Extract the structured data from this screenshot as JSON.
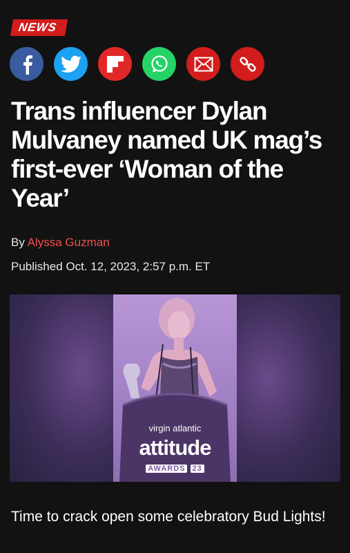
{
  "section_tag": "NEWS",
  "share": [
    {
      "name": "facebook-icon",
      "color": "#3a5ba0"
    },
    {
      "name": "twitter-icon",
      "color": "#1da1f2"
    },
    {
      "name": "flipboard-icon",
      "color": "#e12828"
    },
    {
      "name": "whatsapp-icon",
      "color": "#25d366"
    },
    {
      "name": "email-icon",
      "color": "#d31c1c"
    },
    {
      "name": "link-icon",
      "color": "#d31c1c"
    }
  ],
  "headline": "Trans influencer Dylan Mulvaney named UK mag’s first-ever ‘Woman of the Year’",
  "byline": {
    "prefix": "By ",
    "author": "Alyssa Guzman"
  },
  "published": "Published Oct. 12, 2023, 2:57 p.m. ET",
  "hero": {
    "podium_line1": "virgin atlantic",
    "podium_line2": "attitude",
    "podium_line3_text": "AWARDS",
    "podium_line3_year": "23"
  },
  "body": {
    "paragraph1": "Time to crack open some celebratory Bud Lights!"
  },
  "colors": {
    "background": "#121212",
    "accent_red": "#d31c1c",
    "author_link": "#f0504a"
  }
}
